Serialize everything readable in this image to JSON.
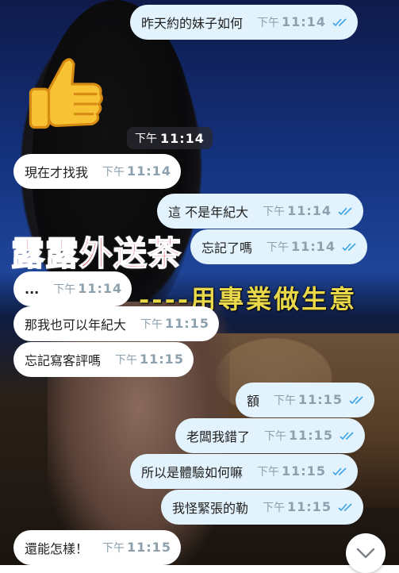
{
  "background": {
    "overlay_title": "露露外送茶",
    "overlay_subtitle": "----用專業做生意"
  },
  "date_chip": {
    "am_pm": "下午",
    "time": "11:14"
  },
  "messages": [
    {
      "dir": "out",
      "text": "昨天約的妹子如何",
      "am_pm": "下午",
      "time": "11:14",
      "read": true
    },
    {
      "dir": "in",
      "text": "現在才找我",
      "am_pm": "下午",
      "time": "11:14"
    },
    {
      "dir": "out",
      "text": "這 不是年紀大",
      "am_pm": "下午",
      "time": "11:14",
      "read": true
    },
    {
      "dir": "out",
      "text": "忘記了嗎",
      "am_pm": "下午",
      "time": "11:14",
      "read": true
    },
    {
      "dir": "in",
      "text": "...",
      "am_pm": "下午",
      "time": "11:14"
    },
    {
      "dir": "in",
      "text": "那我也可以年紀大",
      "am_pm": "下午",
      "time": "11:15"
    },
    {
      "dir": "in",
      "text": "忘記寫客評嗎",
      "am_pm": "下午",
      "time": "11:15"
    },
    {
      "dir": "out",
      "text": "額",
      "am_pm": "下午",
      "time": "11:15",
      "read": true
    },
    {
      "dir": "out",
      "text": "老闆我錯了",
      "am_pm": "下午",
      "time": "11:15",
      "read": true
    },
    {
      "dir": "out",
      "text": "所以是體驗如何嘛",
      "am_pm": "下午",
      "time": "11:15",
      "read": true
    },
    {
      "dir": "out",
      "text": "我怪緊張的勒",
      "am_pm": "下午",
      "time": "11:15",
      "read": true
    },
    {
      "dir": "in",
      "text": "還能怎樣！",
      "am_pm": "下午",
      "time": "11:15"
    }
  ],
  "colors": {
    "outgoing_bubble": "#e3f3fd",
    "incoming_bubble": "#ffffff",
    "read_check": "#3aa3e3",
    "time_text": "#8ca0ae"
  },
  "icons": {
    "reaction": "thumbs-up-emoji",
    "read_receipt": "double-check-icon",
    "scroll": "chevron-down-icon"
  }
}
